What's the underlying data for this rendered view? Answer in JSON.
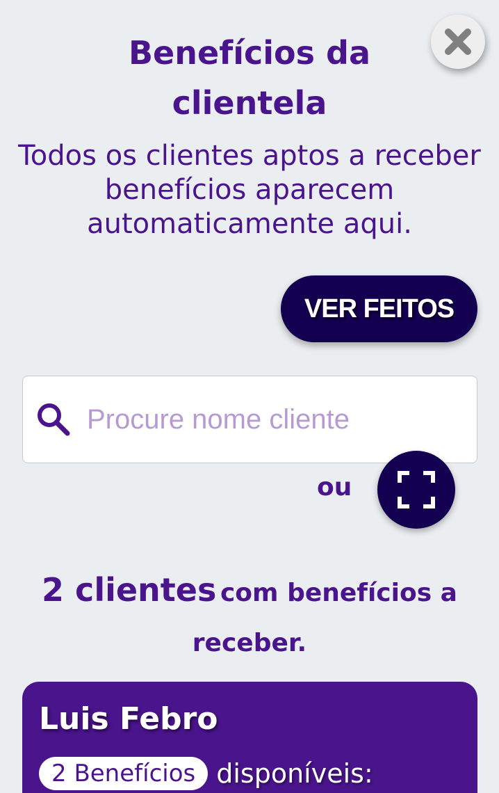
{
  "header": {
    "title": "Benefícios da clientela",
    "subtitle": "Todos os clientes aptos a receber benefícios aparecem automaticamente aqui."
  },
  "actions": {
    "close_icon": "close-icon",
    "ver_feitos_label": "VER FEITOS"
  },
  "search": {
    "placeholder": "Procure nome cliente",
    "value": "",
    "icon": "search-icon"
  },
  "scan": {
    "or_label": "ou",
    "icon": "scan-icon"
  },
  "summary": {
    "count_text": "2 clientes",
    "rest_text": "com benefícios a receber."
  },
  "clients": [
    {
      "name": "Luis Febro",
      "benefits_badge": "2 Benefícios",
      "benefits_suffix": "disponíveis:"
    }
  ],
  "colors": {
    "background": "#ebeef0",
    "primary": "#4a148c",
    "dark_button": "#140050",
    "placeholder": "#b69bd3"
  }
}
